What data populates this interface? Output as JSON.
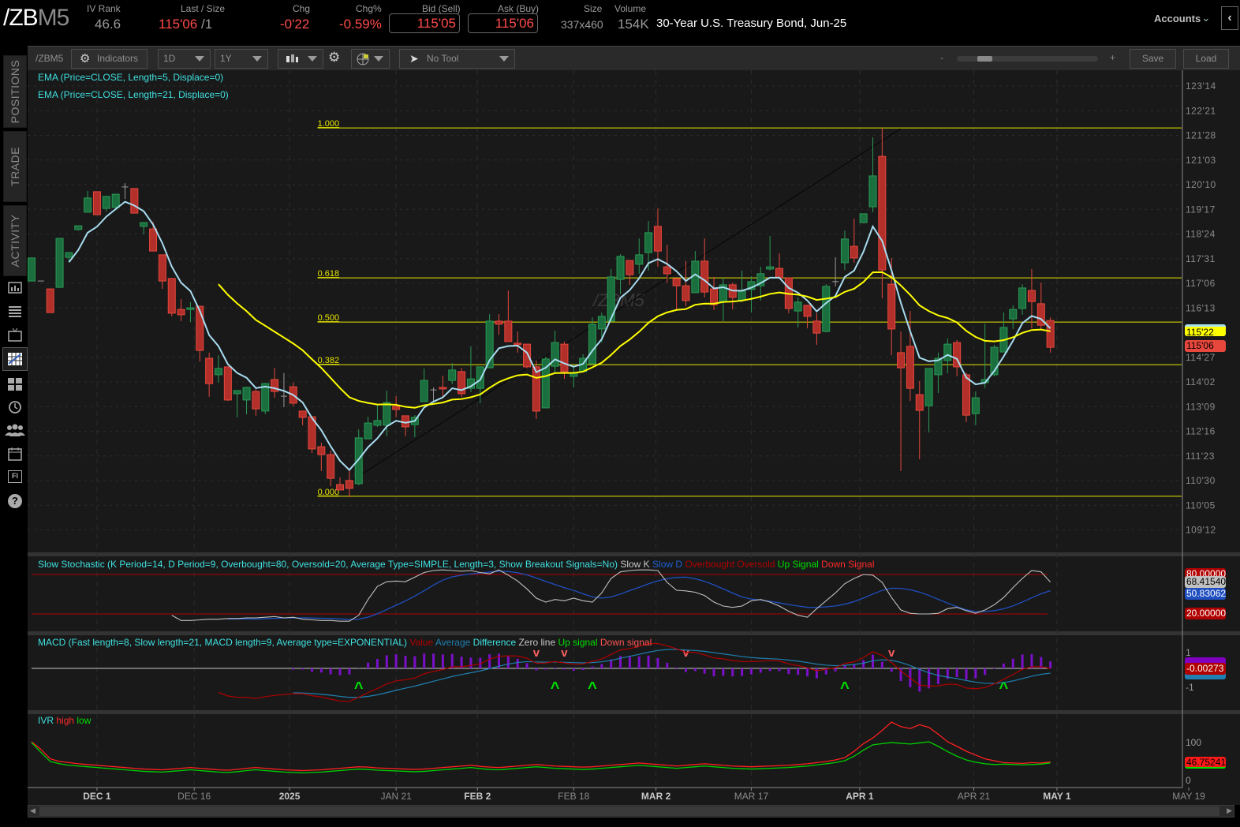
{
  "header": {
    "symbol_main": "/ZB",
    "symbol_suffix": "M5",
    "iv_rank_label": "IV Rank",
    "iv_rank_value": "46.6",
    "last_label": "Last / Size",
    "last_value": "115'06",
    "last_size": "/1",
    "chg_label": "Chg",
    "chg_value": "-0'22",
    "chgpct_label": "Chg%",
    "chgpct_value": "-0.59%",
    "bid_label": "Bid (Sell)",
    "bid_value": "115'05",
    "ask_label": "Ask (Buy)",
    "ask_value": "115'06",
    "size_label": "Size",
    "size_value": "337x460",
    "volume_label": "Volume",
    "volume_value": "154K",
    "description": "30-Year U.S. Treasury Bond, Jun-25",
    "accounts_label": "Accounts"
  },
  "sidebar": {
    "tabs": [
      "POSITIONS",
      "TRADE",
      "ACTIVITY"
    ],
    "icons": [
      "chart-report-icon",
      "list-icon",
      "tv-icon",
      "charts-icon",
      "grid-icon",
      "clock-refresh-icon",
      "people-icon",
      "calendar-icon",
      "fi-icon",
      "help-icon"
    ],
    "fi_text": "FI",
    "help_text": "?"
  },
  "toolbar": {
    "symbol": "/ZBM5",
    "indicators": "Indicators",
    "aggregation": "1D",
    "timeframe": "1Y",
    "drawing_tool": "No Tool",
    "zoom_minus": "-",
    "zoom_plus": "+",
    "zoom_level": 0.2,
    "save": "Save",
    "load": "Load"
  },
  "studies": {
    "ema5": "EMA (Price=CLOSE, Length=5, Displace=0)",
    "ema21": "EMA (Price=CLOSE, Length=21, Displace=0)",
    "watermark": "/ZBM5",
    "stoch": {
      "title": "Slow Stochastic (K Period=14, D Period=9, Overbought=80, Oversold=20, Average Type=SIMPLE, Length=3, Show Breakout Signals=No)",
      "legend": [
        {
          "text": "Slow K",
          "color": "#c8c8c8"
        },
        {
          "text": "Slow D",
          "color": "#1f5fd0"
        },
        {
          "text": "Overbought",
          "color": "#b00000"
        },
        {
          "text": "Oversold",
          "color": "#b00000"
        },
        {
          "text": "Up Signal",
          "color": "#00e000"
        },
        {
          "text": "Down Signal",
          "color": "#ff2a2a"
        }
      ],
      "badges": {
        "overbought": "80.00000",
        "k": "68.41540",
        "d": "50.83062",
        "oversold": "20.00000"
      }
    },
    "macd": {
      "title": "MACD (Fast length=8, Slow length=21, MACD length=9, Average type=EXPONENTIAL)",
      "legend": [
        {
          "text": "Value",
          "color": "#b00000"
        },
        {
          "text": "Average",
          "color": "#1f7fb0"
        },
        {
          "text": "Difference",
          "color": "#40e0e0"
        },
        {
          "text": "Zero line",
          "color": "#c8c8c8"
        },
        {
          "text": "Up signal",
          "color": "#00e000"
        },
        {
          "text": "Down signal",
          "color": "#ff5555"
        }
      ],
      "axis": [
        "1",
        "-1"
      ],
      "badge": "-0.00273"
    },
    "ivr": {
      "title": "IVR",
      "legend": [
        {
          "text": "high",
          "color": "#ff2a2a"
        },
        {
          "text": "low",
          "color": "#00e000"
        }
      ],
      "axis": [
        "100",
        "0"
      ],
      "badge": "46.75241"
    }
  },
  "price_badges": {
    "ema21": "115'22",
    "last": "115'06"
  },
  "chart_data": {
    "type": "candlestick",
    "title": "/ZBM5 1D 1Y",
    "x_unit": "bar index",
    "price_ticks": [
      "123'14",
      "122'21",
      "121'28",
      "121'03",
      "120'10",
      "119'17",
      "118'24",
      "117'31",
      "117'06",
      "116'13",
      "114'27",
      "114'02",
      "113'09",
      "112'16",
      "111'23",
      "110'30",
      "110'05",
      "109'12"
    ],
    "x_ticks": [
      {
        "label": "DEC 1",
        "bar": 7,
        "major": true
      },
      {
        "label": "DEC 16",
        "bar": 17.4,
        "major": false
      },
      {
        "label": "2025",
        "bar": 27.6,
        "major": true
      },
      {
        "label": "JAN 21",
        "bar": 39,
        "major": false
      },
      {
        "label": "FEB 2",
        "bar": 47.7,
        "major": true
      },
      {
        "label": "FEB 18",
        "bar": 58,
        "major": false
      },
      {
        "label": "MAR 2",
        "bar": 66.8,
        "major": true
      },
      {
        "label": "MAR 17",
        "bar": 77,
        "major": false
      },
      {
        "label": "APR 1",
        "bar": 88.6,
        "major": true
      },
      {
        "label": "APR 21",
        "bar": 100.8,
        "major": false
      },
      {
        "label": "MAY 1",
        "bar": 109.7,
        "major": true
      },
      {
        "label": "MAY 19",
        "bar": 123.8,
        "major": false
      }
    ],
    "ohlc": [
      [
        117.26,
        117.99,
        117.26,
        117.99
      ],
      [
        117.26,
        117.26,
        117.26,
        117.26
      ],
      [
        117.01,
        117.01,
        116.26,
        116.26
      ],
      [
        117.06,
        118.61,
        117.06,
        118.61
      ],
      [
        118.01,
        118.16,
        117.89,
        118.16
      ],
      [
        118.89,
        119.01,
        118.86,
        119.01
      ],
      [
        119.44,
        120.11,
        119.44,
        119.89
      ],
      [
        120.09,
        120.09,
        119.36,
        119.36
      ],
      [
        119.56,
        119.94,
        119.46,
        119.94
      ],
      [
        119.59,
        120.01,
        119.54,
        120.01
      ],
      [
        120.24,
        120.36,
        119.86,
        120.24
      ],
      [
        120.19,
        120.19,
        119.41,
        119.41
      ],
      [
        118.99,
        119.11,
        118.74,
        119.11
      ],
      [
        118.91,
        119.14,
        118.21,
        118.21
      ],
      [
        118.09,
        118.09,
        117.01,
        117.26
      ],
      [
        117.34,
        117.34,
        116.14,
        116.24
      ],
      [
        116.36,
        116.69,
        115.99,
        116.19
      ],
      [
        116.36,
        116.59,
        115.96,
        116.41
      ],
      [
        116.46,
        116.46,
        114.71,
        115.06
      ],
      [
        114.81,
        114.99,
        113.59,
        114.01
      ],
      [
        114.29,
        114.91,
        114.04,
        114.49
      ],
      [
        114.54,
        114.54,
        113.46,
        113.49
      ],
      [
        113.69,
        113.79,
        112.94,
        113.79
      ],
      [
        113.49,
        113.91,
        113.04,
        113.89
      ],
      [
        113.76,
        113.84,
        112.99,
        113.21
      ],
      [
        113.14,
        114.04,
        113.04,
        114.01
      ],
      [
        114.14,
        114.51,
        113.56,
        113.76
      ],
      [
        113.61,
        114.34,
        113.26,
        113.61
      ],
      [
        113.91,
        114.04,
        113.29,
        113.39
      ],
      [
        113.14,
        113.14,
        112.69,
        112.94
      ],
      [
        112.96,
        112.96,
        111.81,
        111.94
      ],
      [
        112.01,
        112.14,
        111.24,
        111.76
      ],
      [
        111.76,
        111.89,
        110.76,
        111.01
      ],
      [
        110.81,
        111.04,
        110.64,
        110.64
      ],
      [
        110.94,
        111.24,
        110.41,
        110.69
      ],
      [
        110.84,
        112.56,
        110.79,
        112.29
      ],
      [
        112.26,
        112.96,
        112.26,
        112.76
      ],
      [
        112.69,
        113.36,
        112.64,
        112.84
      ],
      [
        112.69,
        113.79,
        112.34,
        113.41
      ],
      [
        113.29,
        113.61,
        112.94,
        113.19
      ],
      [
        112.99,
        112.99,
        112.34,
        112.64
      ],
      [
        112.71,
        113.01,
        112.31,
        112.94
      ],
      [
        113.44,
        114.49,
        113.44,
        114.11
      ],
      [
        113.81,
        113.89,
        113.46,
        113.81
      ],
      [
        113.89,
        114.26,
        113.56,
        113.84
      ],
      [
        114.11,
        114.66,
        113.99,
        114.44
      ],
      [
        114.39,
        114.51,
        113.59,
        113.69
      ],
      [
        113.86,
        115.19,
        113.74,
        114.16
      ],
      [
        113.86,
        114.54,
        113.39,
        114.54
      ],
      [
        114.51,
        116.21,
        114.51,
        115.99
      ],
      [
        115.99,
        116.21,
        115.56,
        115.89
      ],
      [
        115.99,
        116.96,
        115.34,
        115.34
      ],
      [
        115.29,
        115.66,
        114.99,
        115.24
      ],
      [
        115.26,
        115.26,
        114.49,
        114.54
      ],
      [
        114.54,
        114.74,
        112.89,
        113.14
      ],
      [
        113.24,
        114.86,
        113.24,
        114.79
      ],
      [
        114.56,
        115.69,
        114.36,
        115.31
      ],
      [
        115.26,
        115.34,
        114.16,
        114.39
      ],
      [
        114.24,
        114.59,
        113.89,
        114.34
      ],
      [
        114.39,
        114.94,
        114.39,
        114.81
      ],
      [
        114.64,
        116.11,
        114.64,
        115.89
      ],
      [
        115.74,
        116.26,
        115.31,
        116.14
      ],
      [
        115.99,
        117.64,
        115.99,
        117.39
      ],
      [
        117.31,
        118.11,
        116.84,
        118.04
      ],
      [
        117.91,
        117.91,
        117.14,
        117.46
      ],
      [
        117.79,
        118.61,
        117.49,
        118.09
      ],
      [
        118.16,
        119.16,
        117.59,
        118.79
      ],
      [
        118.99,
        119.56,
        117.71,
        118.21
      ],
      [
        117.71,
        118.41,
        117.21,
        117.49
      ],
      [
        117.34,
        117.34,
        116.36,
        117.11
      ],
      [
        117.11,
        117.89,
        116.46,
        116.64
      ],
      [
        116.89,
        118.21,
        116.89,
        117.89
      ],
      [
        117.89,
        118.61,
        116.74,
        116.91
      ],
      [
        117.01,
        117.39,
        116.34,
        116.51
      ],
      [
        116.61,
        117.36,
        115.99,
        117.14
      ],
      [
        117.14,
        117.21,
        116.36,
        116.74
      ],
      [
        116.66,
        117.59,
        116.59,
        116.94
      ],
      [
        116.99,
        117.41,
        116.26,
        117.24
      ],
      [
        117.11,
        117.71,
        116.64,
        117.49
      ],
      [
        117.64,
        118.69,
        117.59,
        117.71
      ],
      [
        117.66,
        118.14,
        117.36,
        117.36
      ],
      [
        117.36,
        117.36,
        116.24,
        116.39
      ],
      [
        116.31,
        116.74,
        115.79,
        116.59
      ],
      [
        116.49,
        116.49,
        115.76,
        116.14
      ],
      [
        115.99,
        116.24,
        115.24,
        115.61
      ],
      [
        115.66,
        117.16,
        115.64,
        117.09
      ],
      [
        117.24,
        118.01,
        117.09,
        117.24
      ],
      [
        117.84,
        118.86,
        117.61,
        118.59
      ],
      [
        118.36,
        119.24,
        117.84,
        117.99
      ],
      [
        119.11,
        119.39,
        119.09,
        119.39
      ],
      [
        119.61,
        121.81,
        119.44,
        120.59
      ],
      [
        121.21,
        122.11,
        116.71,
        117.61
      ],
      [
        117.16,
        117.99,
        114.91,
        115.74
      ],
      [
        114.99,
        115.66,
        111.24,
        114.51
      ],
      [
        115.19,
        116.31,
        113.46,
        113.86
      ],
      [
        113.66,
        114.09,
        111.61,
        113.16
      ],
      [
        113.31,
        114.49,
        112.46,
        114.49
      ],
      [
        114.29,
        114.99,
        113.71,
        114.81
      ],
      [
        114.74,
        115.44,
        114.34,
        115.26
      ],
      [
        115.31,
        115.39,
        114.24,
        114.54
      ],
      [
        114.29,
        114.36,
        112.79,
        113.01
      ],
      [
        113.06,
        113.76,
        112.69,
        113.56
      ],
      [
        114.04,
        115.91,
        113.86,
        114.14
      ],
      [
        114.29,
        115.24,
        114.24,
        115.16
      ],
      [
        115.01,
        116.26,
        115.01,
        115.79
      ],
      [
        116.06,
        116.49,
        115.74,
        116.36
      ],
      [
        116.39,
        117.16,
        116.19,
        117.04
      ],
      [
        116.96,
        117.64,
        115.76,
        116.61
      ],
      [
        116.54,
        117.21,
        115.74,
        115.86
      ],
      [
        116.01,
        116.11,
        114.99,
        115.16
      ]
    ],
    "fib_levels": [
      {
        "label": "1.000",
        "price": 122.11
      },
      {
        "label": "0.618",
        "price": 117.36
      },
      {
        "label": "0.500",
        "price": 115.96
      },
      {
        "label": "0.382",
        "price": 114.61
      },
      {
        "label": "0.000",
        "price": 110.44
      }
    ],
    "fib_start_bar": 30.6,
    "trendline": {
      "from": {
        "bar": 34,
        "price": 110.89
      },
      "to": {
        "bar": 93,
        "price": 122.09
      }
    },
    "stoch_k_start_bar": 15,
    "stoch_k": [
      18,
      10,
      10,
      11,
      12,
      12,
      13,
      13,
      14,
      14,
      15,
      16,
      14,
      15,
      12,
      11,
      10,
      10,
      9,
      9,
      18,
      42,
      62,
      69,
      70,
      69,
      76,
      83,
      86,
      87,
      86,
      85,
      86,
      83,
      81,
      87,
      79,
      70,
      58,
      44,
      38,
      42,
      40,
      44,
      40,
      38,
      52,
      74,
      84,
      86,
      87,
      87,
      86,
      68,
      56,
      55,
      53,
      48,
      38,
      32,
      30,
      32,
      40,
      42,
      38,
      32,
      24,
      18,
      15,
      28,
      40,
      52,
      66,
      74,
      80,
      79,
      68,
      45,
      26,
      21,
      20,
      20,
      21,
      28,
      30,
      25,
      21,
      26,
      34,
      45,
      60,
      74,
      86,
      84,
      68.4
    ],
    "ivr_high": [
      100,
      80,
      55,
      48,
      45,
      42,
      40,
      38,
      36,
      34,
      32,
      30,
      28,
      27,
      26,
      28,
      30,
      32,
      30,
      28,
      26,
      25,
      27,
      30,
      32,
      30,
      28,
      26,
      25,
      24,
      25,
      26,
      28,
      30,
      32,
      34,
      33,
      31,
      30,
      29,
      28,
      27,
      28,
      30,
      32,
      34,
      36,
      38,
      35,
      33,
      32,
      34,
      36,
      38,
      40,
      38,
      36,
      35,
      34,
      33,
      34,
      36,
      38,
      40,
      42,
      44,
      42,
      40,
      38,
      36,
      38,
      40,
      42,
      40,
      38,
      36,
      35,
      34,
      35,
      36,
      37,
      38,
      40,
      42,
      45,
      48,
      52,
      58,
      75,
      95,
      110,
      130,
      152,
      140,
      135,
      145,
      138,
      120,
      100,
      88,
      75,
      65,
      55,
      50,
      45,
      44,
      43,
      45,
      44,
      46.75
    ],
    "ivr_low": [
      98,
      72,
      48,
      42,
      38,
      36,
      34,
      32,
      30,
      28,
      26,
      24,
      22,
      21,
      20,
      22,
      24,
      26,
      24,
      22,
      20,
      19,
      21,
      24,
      26,
      24,
      22,
      20,
      19,
      18,
      19,
      20,
      22,
      24,
      26,
      28,
      27,
      25,
      24,
      23,
      22,
      21,
      22,
      24,
      26,
      28,
      30,
      32,
      29,
      27,
      26,
      28,
      30,
      32,
      34,
      32,
      30,
      29,
      28,
      27,
      28,
      30,
      32,
      34,
      36,
      38,
      36,
      34,
      32,
      30,
      32,
      34,
      36,
      34,
      32,
      30,
      29,
      28,
      29,
      30,
      31,
      32,
      34,
      36,
      39,
      42,
      45,
      50,
      62,
      78,
      92,
      95,
      98,
      96,
      94,
      97,
      100,
      88,
      74,
      62,
      52,
      46,
      42,
      40,
      41,
      40,
      39,
      40,
      41,
      44
    ]
  }
}
